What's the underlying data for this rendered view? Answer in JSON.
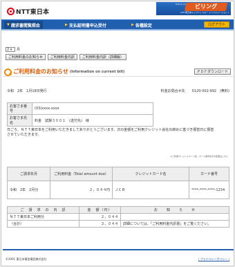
{
  "header": {
    "logo_text": "NTT東日本",
    "brand_name": "ビリング",
    "brand_sub": "Billing Information Service",
    "brand_links": "| NTT東日本トップへ | ハロー インフォメーション |"
  },
  "nav": {
    "tabs": [
      {
        "label": "請求書閲覧照会"
      },
      {
        "label": "支払証明書申込受付"
      },
      {
        "label": "各種設定"
      }
    ],
    "logout": "ログアウト"
  },
  "controls": {
    "month_select": "2",
    "month_suffix": "月",
    "buttons": [
      "ご利用料金のお知らせ",
      "ご利用料金内訳",
      "ご利用料金内訳（詳細版）"
    ]
  },
  "page": {
    "title": "ご利用料金のお知らせ",
    "title_en": "(Information on current bill)",
    "pdf_button": "ＰＤＦダウンロード",
    "date": "令和　2年　1月18日発行",
    "contact": "料金お問合せ先　　0120-002-992　(無料)"
  },
  "customer": {
    "rows": [
      {
        "label": "お客さま番号",
        "value": "(03)xxxx-xxxx"
      },
      {
        "label": "お客さま氏名",
        "value": "料金　試験３００１　(送付先)　様"
      }
    ]
  },
  "notice": "日ごろ、ＮＴＴ東日本をご利用いただきましてありがとうございます。次の金額をご利用クレジット会社の締めに基づき振替日に振替させていただきます。",
  "fine_print": "※ご利用クレジットカード名・カード番号表示の変更はこちら",
  "billing_table": {
    "headers": [
      "ご請求年月",
      "ご利用料金（Total amount due）",
      "クレジットカード名",
      "カード番号"
    ],
    "row": [
      "令和　2年　2月分",
      "２，０４４円",
      "ＪＣＢ",
      "****-****-****-1234"
    ]
  },
  "detail_table": {
    "headers": [
      "ご　請　求　の　内　訳",
      "金　額（円）",
      "お　　知　　ら　　せ"
    ],
    "rows": [
      [
        "ＮＴＴ東日本ご利用分",
        "２，０４４",
        ""
      ],
      [
        "（合計）",
        "２，０４４",
        "詳細については、「ご利用料金内訳書」をご覧ください。"
      ]
    ]
  },
  "footer": {
    "copyright": "©2001 東日本電信電話株式会社",
    "privacy": "| プライバシーポリシー |"
  },
  "colors": {
    "nav_blue": "#1f5fae",
    "title_orange": "#e05a00",
    "logo_red": "#e60012",
    "logout_yellow": "#f5b400"
  }
}
